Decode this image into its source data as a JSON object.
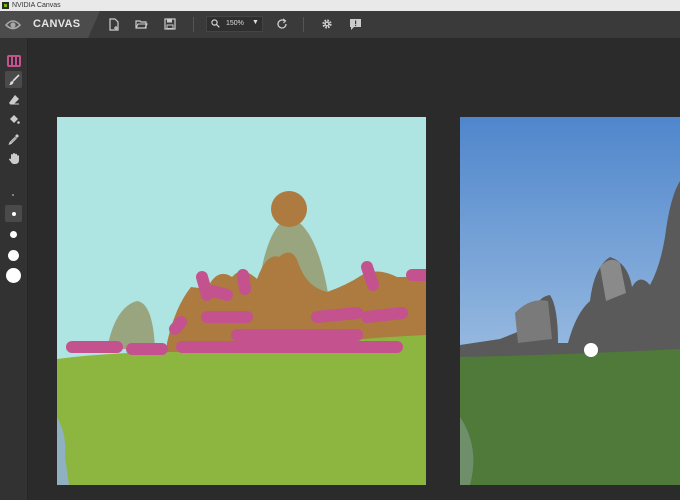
{
  "window": {
    "title": "NVIDIA Canvas"
  },
  "app": {
    "name": "CANVAS"
  },
  "toolbar": {
    "zoom_value": "150%",
    "buttons": [
      "new-file",
      "open-folder",
      "save",
      "reset",
      "settings",
      "feedback"
    ]
  },
  "tools": [
    "material-palette",
    "brush",
    "eraser",
    "fill-bucket",
    "eyedropper",
    "pan-hand"
  ],
  "brush_sizes": [
    "tiny",
    "small",
    "medium",
    "large",
    "xlarge"
  ],
  "colors": {
    "sky": "#aee4e1",
    "grass": "#8cb640",
    "rock": "#ad7a3f",
    "mountain": "#99a57f",
    "flowers": "#c4528e",
    "water": "#8fb1c2",
    "accent": "#76b900"
  }
}
